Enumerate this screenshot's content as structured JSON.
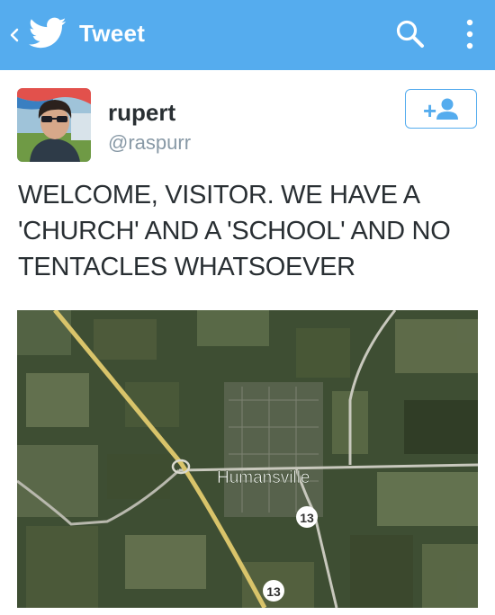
{
  "appbar": {
    "title": "Tweet",
    "back_icon": "chevron-left-icon",
    "logo_icon": "twitter-bird-icon",
    "search_icon": "search-icon",
    "more_icon": "overflow-menu-icon",
    "color": "#55acee"
  },
  "user": {
    "name": "rupert",
    "handle": "@raspurr",
    "follow_button": {
      "label": "+",
      "icon": "add-person-icon"
    }
  },
  "tweet": {
    "text": "WELCOME, VISITOR. WE HAVE A 'CHURCH' AND A 'SCHOOL' AND NO TENTACLES WHATSOEVER"
  },
  "map": {
    "place_label": "Humansville",
    "route_shield_upper": "13",
    "route_shield_lower": "13"
  }
}
